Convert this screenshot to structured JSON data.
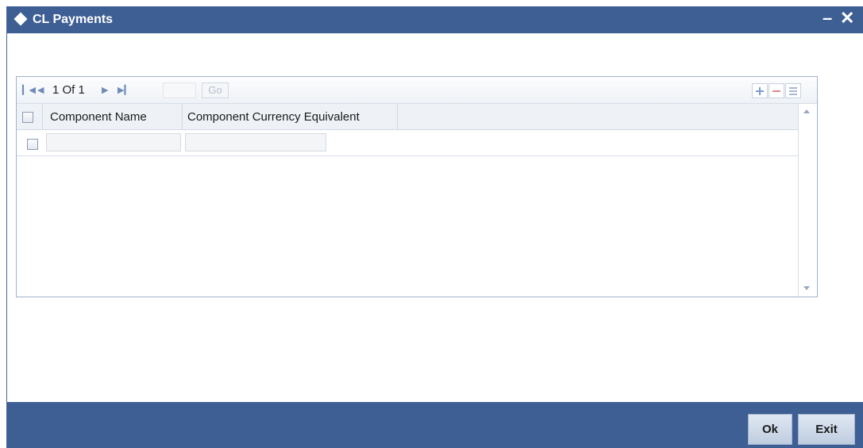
{
  "window": {
    "title": "CL Payments",
    "minimize_label": "–",
    "close_label": "✕"
  },
  "pager": {
    "first_icon": "first-page-icon",
    "prev_icon": "prev-page-icon",
    "next_icon": "next-page-icon",
    "last_icon": "last-page-icon",
    "page_text": "1 Of 1",
    "goto_value": "",
    "go_label": "Go"
  },
  "toolbar": {
    "add_icon": "plus-icon",
    "delete_icon": "minus-icon",
    "view_icon": "list-icon"
  },
  "table": {
    "columns": [
      {
        "label": "Component Name"
      },
      {
        "label": "Component Currency Equivalent"
      }
    ],
    "rows": [
      {
        "component_name": "",
        "currency_equivalent": ""
      }
    ]
  },
  "footer": {
    "ok_label": "Ok",
    "exit_label": "Exit"
  },
  "colors": {
    "titlebar": "#3e5f94",
    "footer": "#3e5f94",
    "grid_border": "#9fb2cc",
    "pager_icon": "#6f8cb8"
  }
}
